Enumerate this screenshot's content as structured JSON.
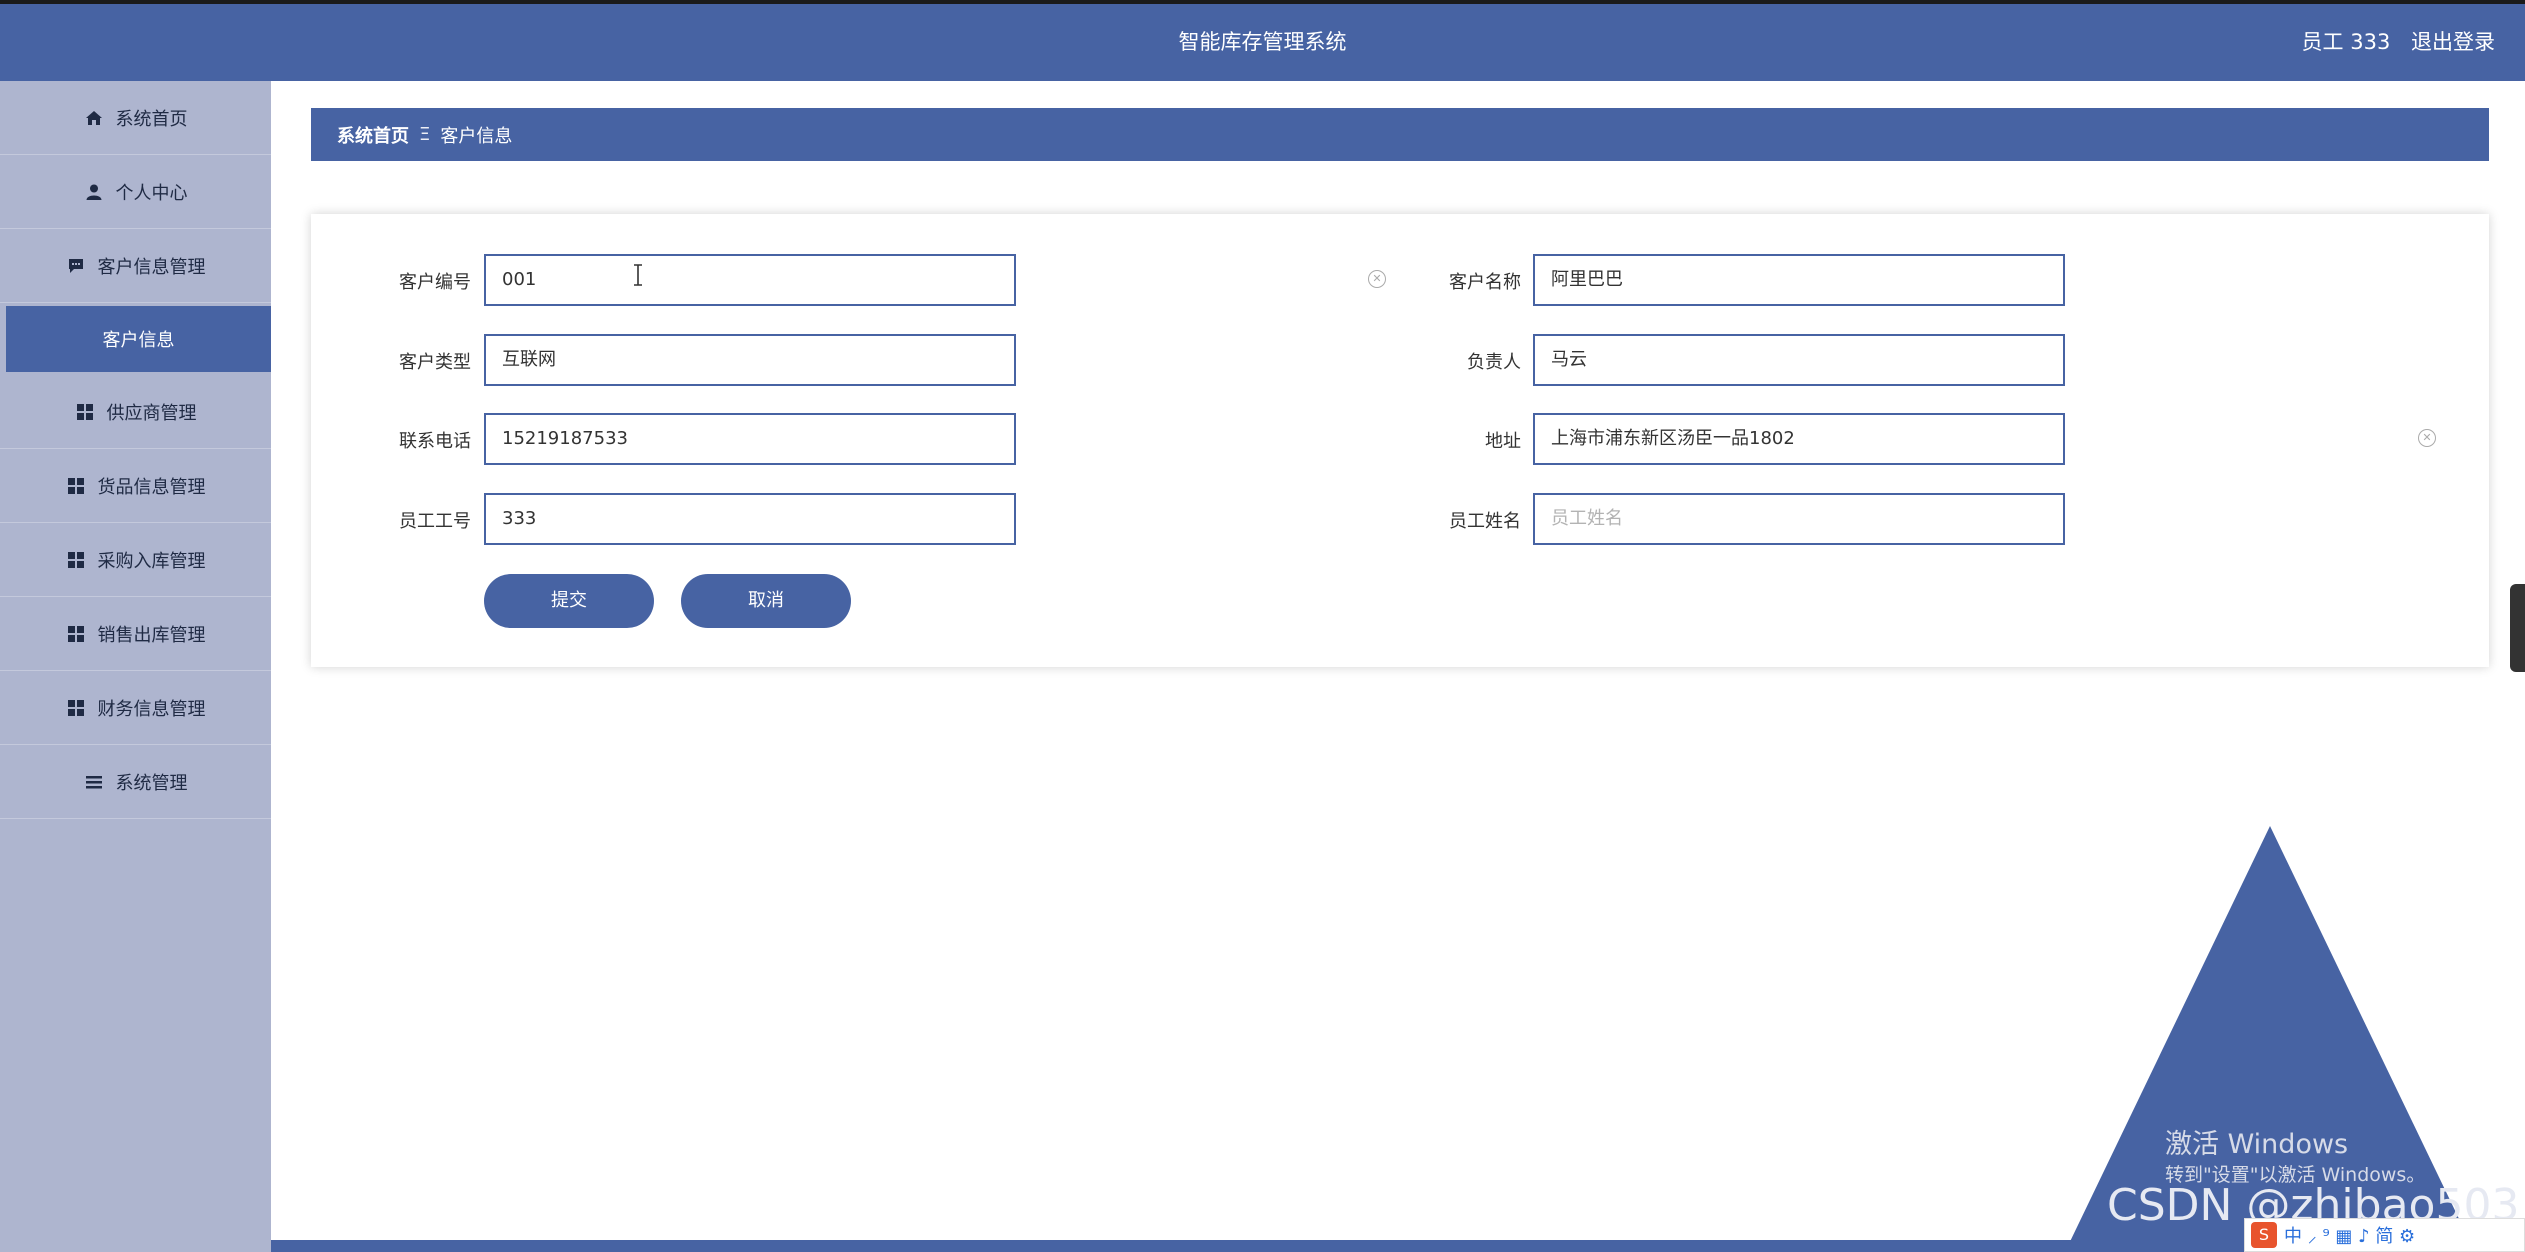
{
  "header": {
    "title": "智能库存管理系统",
    "user_label": "员工 333",
    "logout_label": "退出登录"
  },
  "sidebar": {
    "items": [
      {
        "label": "系统首页",
        "icon": "home-icon"
      },
      {
        "label": "个人中心",
        "icon": "user-icon"
      },
      {
        "label": "客户信息管理",
        "icon": "chat-icon"
      },
      {
        "label": "客户信息",
        "icon": "",
        "active": true
      },
      {
        "label": "供应商管理",
        "icon": "grid-icon"
      },
      {
        "label": "货品信息管理",
        "icon": "grid-icon"
      },
      {
        "label": "采购入库管理",
        "icon": "grid-icon"
      },
      {
        "label": "销售出库管理",
        "icon": "grid-icon"
      },
      {
        "label": "财务信息管理",
        "icon": "grid-icon"
      },
      {
        "label": "系统管理",
        "icon": "list-icon"
      }
    ]
  },
  "breadcrumb": {
    "home": "系统首页",
    "separator": "Ξ",
    "current": "客户信息"
  },
  "form": {
    "customer_id": {
      "label": "客户编号",
      "value": "001"
    },
    "customer_name": {
      "label": "客户名称",
      "value": "阿里巴巴"
    },
    "customer_type": {
      "label": "客户类型",
      "value": "互联网"
    },
    "manager": {
      "label": "负责人",
      "value": "马云"
    },
    "phone": {
      "label": "联系电话",
      "value": "15219187533"
    },
    "address": {
      "label": "地址",
      "value": "上海市浦东新区汤臣一品1802"
    },
    "employee_id": {
      "label": "员工工号",
      "value": "333"
    },
    "employee_name": {
      "label": "员工姓名",
      "value": "",
      "placeholder": "员工姓名"
    },
    "submit_label": "提交",
    "cancel_label": "取消"
  },
  "overlays": {
    "windows_activate_title": "激活 Windows",
    "windows_activate_hint": "转到\"设置\"以激活 Windows。",
    "csdn_watermark": "CSDN @zhibao503",
    "ime_text": "中 ⸝ ⁹ ▦ ♪ 简 ⚙"
  },
  "colors": {
    "primary": "#4763a3",
    "sidebar_bg": "#aeb5cf"
  }
}
